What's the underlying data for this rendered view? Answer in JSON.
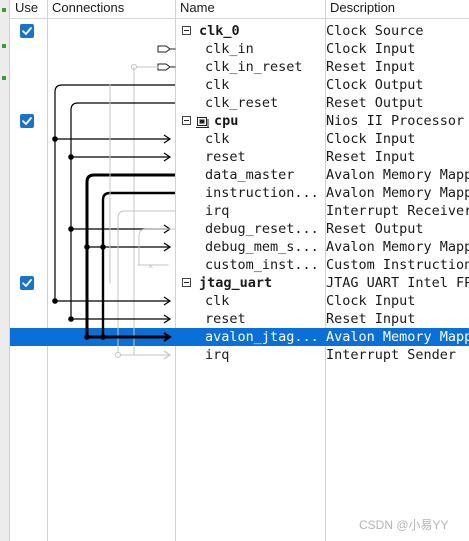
{
  "columns": {
    "use": "Use",
    "connections": "Connections",
    "name": "Name",
    "description": "Description"
  },
  "rows": [
    {
      "name": "clk_0",
      "description": "Clock Source",
      "level": "top",
      "checkbox": true,
      "expander": true
    },
    {
      "name": "clk_in",
      "description": "Clock Input",
      "level": "child"
    },
    {
      "name": "clk_in_reset",
      "description": "Reset Input",
      "level": "child"
    },
    {
      "name": "clk",
      "description": "Clock Output",
      "level": "child"
    },
    {
      "name": "clk_reset",
      "description": "Reset Output",
      "level": "child"
    },
    {
      "name": "cpu",
      "description": "Nios II Processor",
      "level": "top",
      "checkbox": true,
      "expander": true,
      "icon": "processor-icon"
    },
    {
      "name": "clk",
      "description": "Clock Input",
      "level": "child"
    },
    {
      "name": "reset",
      "description": "Reset Input",
      "level": "child"
    },
    {
      "name": "data_master",
      "description": "Avalon Memory Mapp",
      "level": "child"
    },
    {
      "name": "instruction...",
      "description": "Avalon Memory Mapp",
      "level": "child"
    },
    {
      "name": "irq",
      "description": "Interrupt Receiver",
      "level": "child"
    },
    {
      "name": "debug_reset...",
      "description": "Reset Output",
      "level": "child"
    },
    {
      "name": "debug_mem_s...",
      "description": "Avalon Memory Mapp",
      "level": "child"
    },
    {
      "name": "custom_inst...",
      "description": "Custom Instruction",
      "level": "child"
    },
    {
      "name": "jtag_uart",
      "description": "JTAG UART Intel FP",
      "level": "top",
      "checkbox": true,
      "expander": true
    },
    {
      "name": "clk",
      "description": "Clock Input",
      "level": "child"
    },
    {
      "name": "reset",
      "description": "Reset Input",
      "level": "child"
    },
    {
      "name": "avalon_jtag...",
      "description": "Avalon Memory Mapp",
      "level": "child",
      "selected": true
    },
    {
      "name": "irq",
      "description": "Interrupt Sender",
      "level": "child"
    }
  ],
  "colors": {
    "selection": "#0a6fd6",
    "checkbox": "#1a73c8",
    "connection_active": "#000000",
    "connection_inactive": "#c4c4c4"
  },
  "watermark": "CSDN @小易YY"
}
